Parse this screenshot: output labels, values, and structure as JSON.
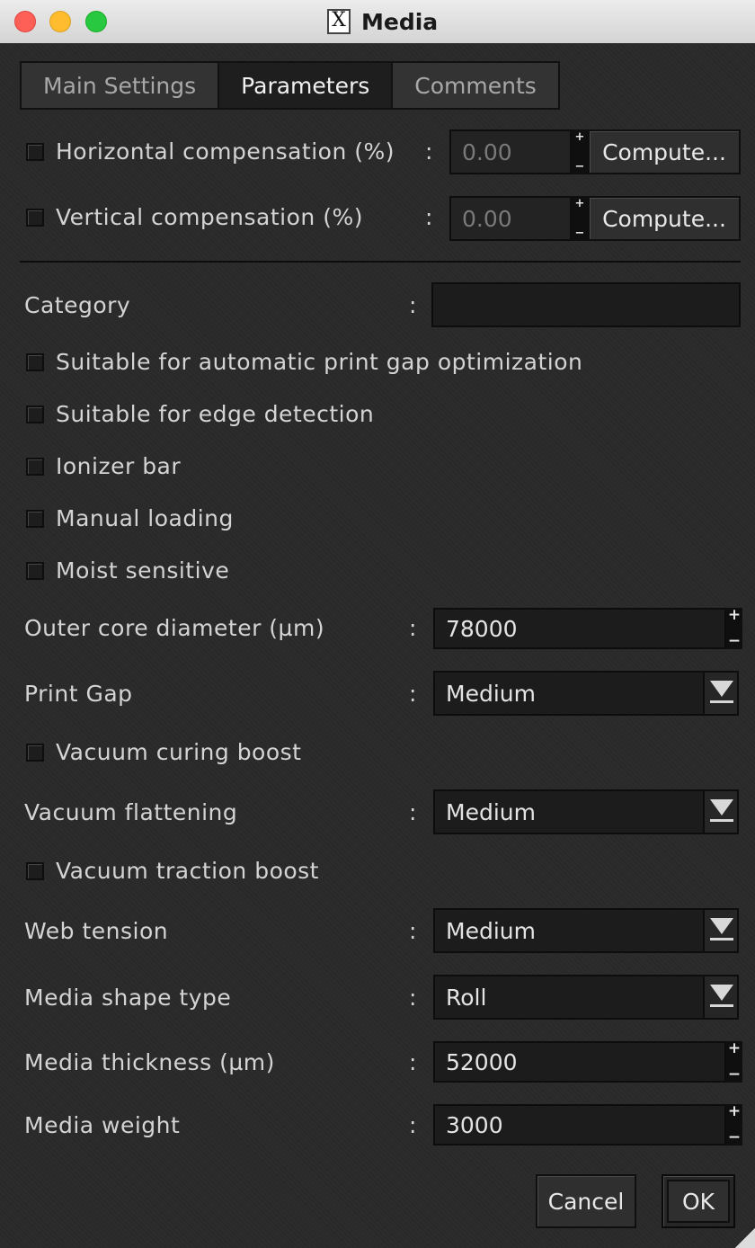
{
  "window": {
    "title": "Media",
    "app_icon": "x11-icon"
  },
  "tabs": [
    {
      "label": "Main Settings",
      "active": false
    },
    {
      "label": "Parameters",
      "active": true
    },
    {
      "label": "Comments",
      "active": false
    }
  ],
  "compensation": {
    "horizontal": {
      "label": "Horizontal compensation (%)",
      "checked": false,
      "value": "0.00",
      "compute_label": "Compute..."
    },
    "vertical": {
      "label": "Vertical compensation (%)",
      "checked": false,
      "value": "0.00",
      "compute_label": "Compute..."
    }
  },
  "category": {
    "label": "Category",
    "value": ""
  },
  "checkboxes": {
    "print_gap_opt": {
      "label": "Suitable for automatic print gap optimization",
      "checked": false
    },
    "edge_detection": {
      "label": "Suitable for edge detection",
      "checked": false
    },
    "ionizer_bar": {
      "label": "Ionizer bar",
      "checked": false
    },
    "manual_loading": {
      "label": "Manual loading",
      "checked": false
    },
    "moist_sensitive": {
      "label": "Moist sensitive",
      "checked": false
    },
    "vacuum_curing_boost": {
      "label": "Vacuum curing boost",
      "checked": false
    },
    "vacuum_traction_boost": {
      "label": "Vacuum traction boost",
      "checked": false
    }
  },
  "fields": {
    "outer_core_diameter": {
      "label": "Outer core diameter (µm)",
      "value": "78000"
    },
    "print_gap": {
      "label": "Print Gap",
      "value": "Medium"
    },
    "vacuum_flattening": {
      "label": "Vacuum flattening",
      "value": "Medium"
    },
    "web_tension": {
      "label": "Web tension",
      "value": "Medium"
    },
    "media_shape_type": {
      "label": "Media shape type",
      "value": "Roll"
    },
    "media_thickness": {
      "label": "Media thickness (µm)",
      "value": "52000"
    },
    "media_weight": {
      "label": "Media weight",
      "value": "3000"
    }
  },
  "colon": ":",
  "spin": {
    "plus": "+",
    "minus": "−"
  },
  "buttons": {
    "cancel": "Cancel",
    "ok": "OK"
  }
}
